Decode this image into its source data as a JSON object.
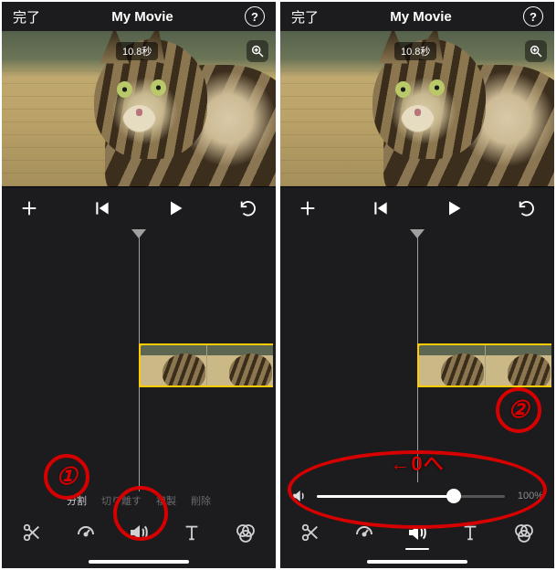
{
  "header": {
    "done_label": "完了",
    "title": "My Movie",
    "help_glyph": "?"
  },
  "preview": {
    "timer_text": "10.8秒"
  },
  "edit_actions": {
    "split": "分割",
    "detach": "切り離す",
    "duplicate": "複製",
    "delete": "削除"
  },
  "volume": {
    "percent_label": "100%",
    "fill_percent": 73
  },
  "annotations": {
    "step1": "①",
    "step2": "②",
    "slider_hint": "←0へ"
  },
  "icons": {
    "help": "help-icon",
    "zoom": "zoom-icon",
    "add": "add-icon",
    "skip_back": "skip-back-icon",
    "play": "play-icon",
    "undo": "undo-icon",
    "scissors": "scissors-icon",
    "speed": "speed-icon",
    "volume": "volume-icon",
    "text": "text-icon",
    "filters": "filters-icon",
    "speaker_small": "speaker-small-icon"
  }
}
